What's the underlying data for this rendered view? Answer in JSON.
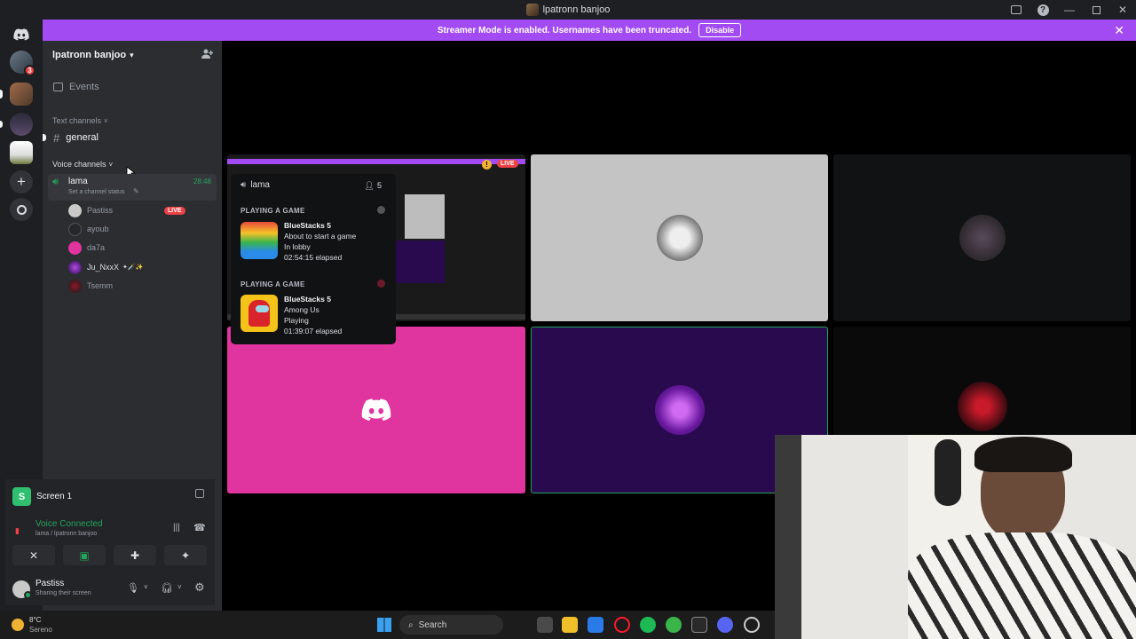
{
  "window": {
    "title": "lpatronn banjoo"
  },
  "banner": {
    "text": "Streamer Mode is enabled. Usernames have been truncated.",
    "button": "Disable",
    "close": "✕"
  },
  "guilds": {
    "badge": "3"
  },
  "server": {
    "name": "lpatronn banjoo"
  },
  "sidebar": {
    "events_label": "Events",
    "text_category": "Text channels",
    "text_channel": "general",
    "voice_category": "Voice channels",
    "voice_channel": {
      "name": "lama",
      "time": "28:48",
      "status_placeholder": "Set a channel status",
      "users": [
        {
          "name": "Pastiss",
          "live": "LIVE"
        },
        {
          "name": "ayoub"
        },
        {
          "name": "da7a"
        },
        {
          "name": "Ju_NxxX",
          "suffix": "✦🗡️✨"
        },
        {
          "name": "Tsemm"
        }
      ]
    }
  },
  "screen_panel": {
    "title": "Screen 1",
    "voice_status": "Voice Connected",
    "voice_location": "lama / lpatronn banjoo"
  },
  "user_panel": {
    "name": "Pastiss",
    "status": "Sharing their screen"
  },
  "popover": {
    "channel": "lama",
    "count": "5",
    "activities": [
      {
        "section": "PLAYING A GAME",
        "app": "BlueStacks 5",
        "detail": "About to start a game",
        "state": "In lobby",
        "elapsed": "02:54:15 elapsed",
        "icon": "bluestacks-icon"
      },
      {
        "section": "PLAYING A GAME",
        "app": "BlueStacks 5",
        "detail": "Among Us",
        "state": "Playing",
        "elapsed": "01:39:07 elapsed",
        "icon": "among-us-icon"
      }
    ]
  },
  "stream_tile": {
    "live": "LIVE"
  },
  "taskbar": {
    "weather_temp": "8°C",
    "weather_text": "Sereno",
    "search_label": "Search"
  },
  "colors": {
    "banner": "#a24bf2",
    "tile_gray": "#c4c4c4",
    "tile_pink": "#e0349e",
    "tile_purple": "#2a0a4f",
    "voice_green": "#23a55a",
    "live_red": "#ed4245"
  }
}
